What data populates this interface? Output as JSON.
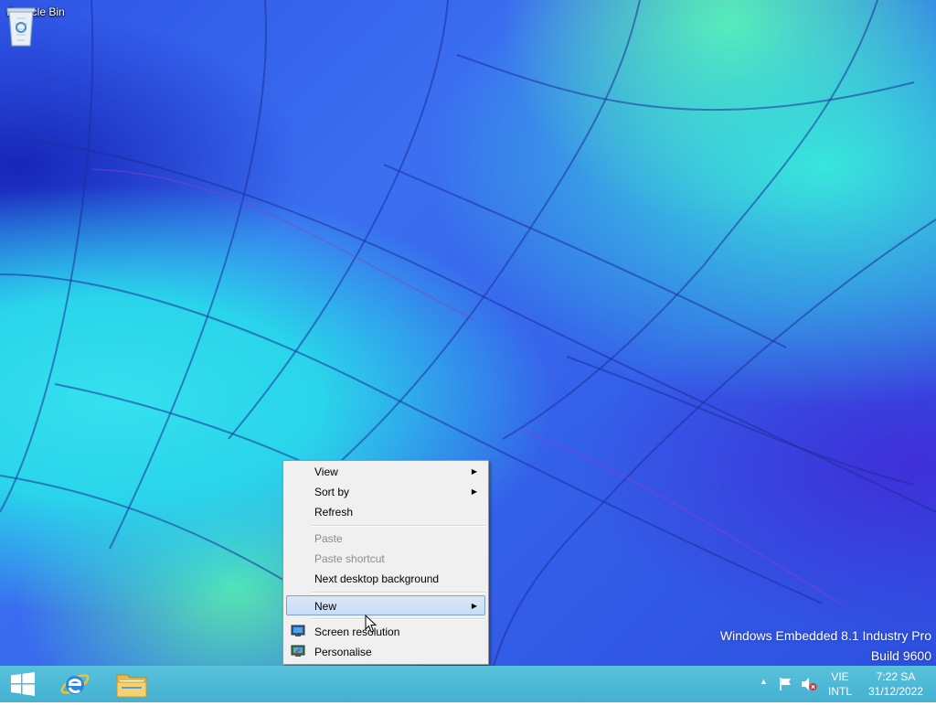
{
  "desktop": {
    "icons": [
      {
        "label": "Recycle Bin",
        "icon": "recycle-bin-icon"
      }
    ],
    "watermark": {
      "line1": "Windows Embedded 8.1 Industry Pro",
      "line2": "Build 9600"
    }
  },
  "context_menu": {
    "items": [
      {
        "label": "View",
        "submenu": true,
        "enabled": true
      },
      {
        "label": "Sort by",
        "submenu": true,
        "enabled": true
      },
      {
        "label": "Refresh",
        "submenu": false,
        "enabled": true
      },
      {
        "label": "Paste",
        "submenu": false,
        "enabled": false
      },
      {
        "label": "Paste shortcut",
        "submenu": false,
        "enabled": false
      },
      {
        "label": "Next desktop background",
        "submenu": false,
        "enabled": true
      },
      {
        "label": "New",
        "submenu": true,
        "enabled": true,
        "highlighted": true
      },
      {
        "label": "Screen resolution",
        "submenu": false,
        "enabled": true,
        "icon": "screen-resolution-icon"
      },
      {
        "label": "Personalise",
        "submenu": false,
        "enabled": true,
        "icon": "personalise-icon"
      }
    ]
  },
  "taskbar": {
    "buttons": [
      {
        "name": "start",
        "icon": "windows-logo-icon"
      },
      {
        "name": "internet-explorer",
        "icon": "internet-explorer-icon"
      },
      {
        "name": "file-explorer",
        "icon": "folder-icon"
      }
    ],
    "tray": {
      "icons": [
        "chevron-up-icon",
        "flag-icon",
        "speaker-muted-icon"
      ],
      "language": {
        "line1": "VIE",
        "line2": "INTL"
      },
      "clock": {
        "time": "7:22 SA",
        "date": "31/12/2022"
      }
    }
  },
  "colors": {
    "taskbar": "#4ab4d2",
    "menu_bg": "#f0f0f0",
    "menu_highlight": "#cde0f6",
    "disabled_text": "#8c8c8c"
  }
}
